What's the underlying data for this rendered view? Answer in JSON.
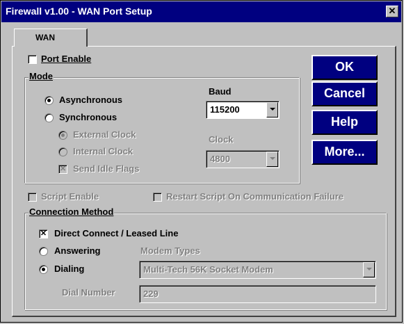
{
  "window": {
    "title": "Firewall v1.00 - WAN Port Setup",
    "close_glyph": "✕"
  },
  "tab": {
    "label": "WAN"
  },
  "port_enable": {
    "label": "Port Enable",
    "checked": false
  },
  "mode": {
    "group_label": "Mode",
    "asynchronous": {
      "label": "Asynchronous",
      "selected": true
    },
    "synchronous": {
      "label": "Synchronous",
      "selected": false
    },
    "external_clock": {
      "label": "External Clock",
      "selected": true,
      "enabled": false
    },
    "internal_clock": {
      "label": "Internal Clock",
      "selected": false,
      "enabled": false
    },
    "send_idle_flags": {
      "label": "Send Idle Flags",
      "checked": true,
      "enabled": false,
      "mark": "✕"
    },
    "baud_label": "Baud",
    "baud_value": "115200",
    "clock_label": "Clock",
    "clock_value": "4800"
  },
  "buttons": {
    "ok": "OK",
    "cancel": "Cancel",
    "help": "Help",
    "more": "More..."
  },
  "script_enable": {
    "label": "Script Enable",
    "enabled": false
  },
  "restart_script": {
    "label": "Restart Script On Communication Failure",
    "enabled": false
  },
  "connection": {
    "group_label": "Connection Method",
    "direct_connect": {
      "label": "Direct Connect / Leased Line",
      "checked": true,
      "mark": "✕"
    },
    "answering": {
      "label": "Answering",
      "selected": false
    },
    "dialing": {
      "label": "Dialing",
      "selected": true
    },
    "modem_types_label": "Modem Types",
    "modem_value": "Multi-Tech 56K Socket Modem",
    "dial_number_label": "Dial Number",
    "dial_number_value": "229"
  },
  "colors": {
    "face": "#c0c0c0",
    "titlebar": "#000080",
    "button": "#000080",
    "disabled": "#808080"
  }
}
